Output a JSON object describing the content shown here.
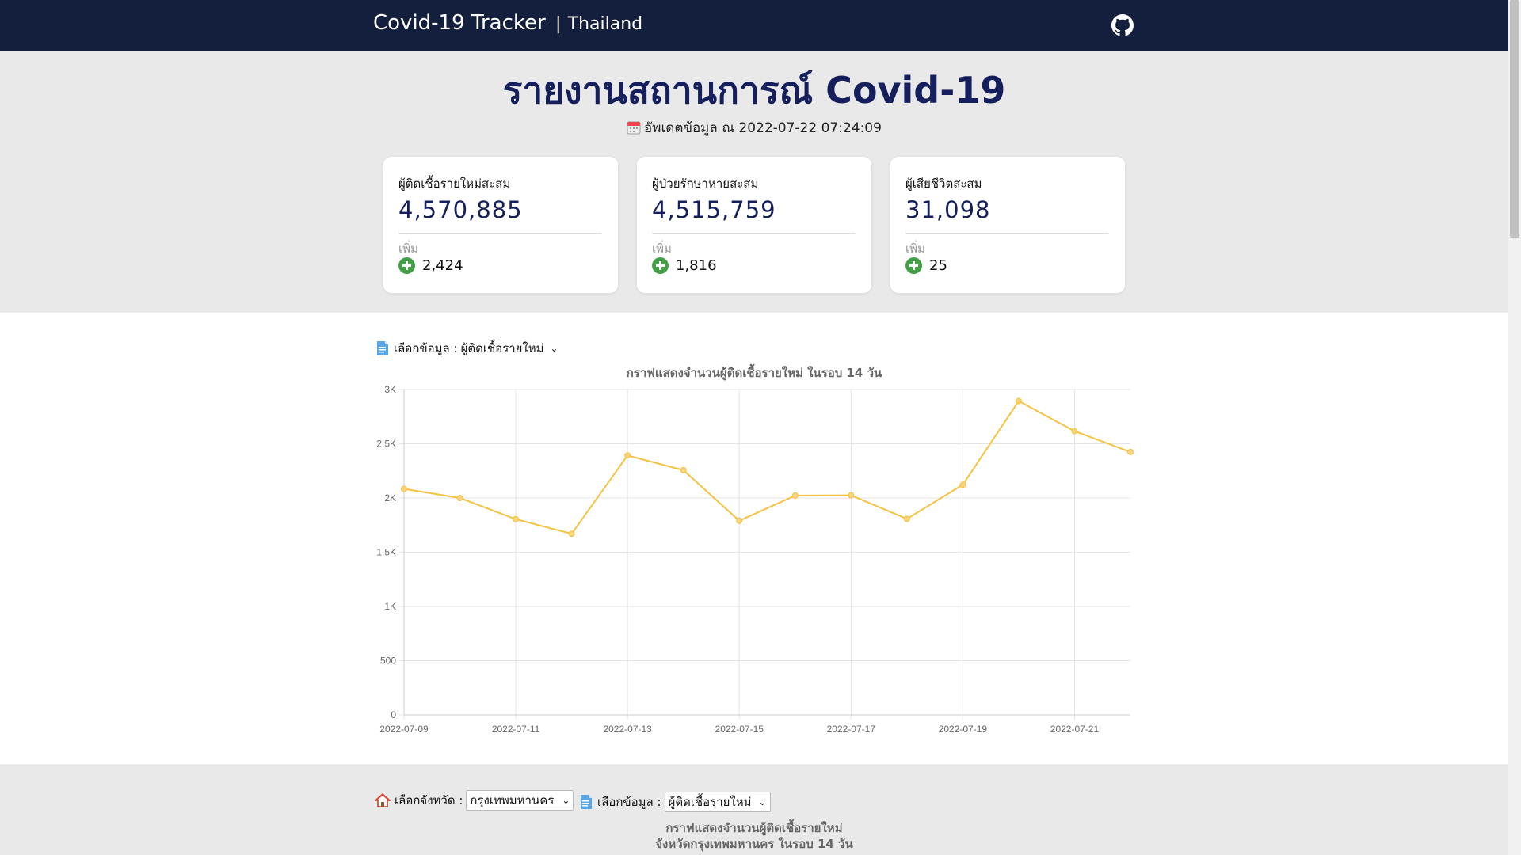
{
  "navbar": {
    "brand": "Covid-19 Tracker",
    "separator": "|",
    "country": "Thailand",
    "github_icon": "github-icon"
  },
  "header": {
    "title": "รายงานสถานการณ์ Covid-19",
    "updated": "อัพเดตข้อมูล ณ 2022-07-22 07:24:09",
    "calendar_icon": "calendar-icon"
  },
  "cards": [
    {
      "label": "ผู้ติดเชื้อรายใหม่สะสม",
      "value": "4,570,885",
      "increase_label": "เพิ่ม",
      "increase": "2,424"
    },
    {
      "label": "ผู้ป่วยรักษาหายสะสม",
      "value": "4,515,759",
      "increase_label": "เพิ่ม",
      "increase": "1,816"
    },
    {
      "label": "ผู้เสียชีวิตสะสม",
      "value": "31,098",
      "increase_label": "เพิ่ม",
      "increase": "25"
    }
  ],
  "main_selector": {
    "label": "เลือกข้อมูล :",
    "selected": "ผู้ติดเชื้อรายใหม่"
  },
  "chart_data": {
    "type": "line",
    "title": "กราฟแสดงจำนวนผู้ติดเชื้อรายใหม่ ในรอบ 14 วัน",
    "x": [
      "2022-07-09",
      "2022-07-10",
      "2022-07-11",
      "2022-07-12",
      "2022-07-13",
      "2022-07-14",
      "2022-07-15",
      "2022-07-16",
      "2022-07-17",
      "2022-07-18",
      "2022-07-19",
      "2022-07-20",
      "2022-07-21",
      "2022-07-22"
    ],
    "x_tick_labels": [
      "2022-07-09",
      "2022-07-11",
      "2022-07-13",
      "2022-07-15",
      "2022-07-17",
      "2022-07-19",
      "2022-07-21"
    ],
    "series": [
      {
        "values": [
          2084,
          2000,
          1804,
          1670,
          2392,
          2256,
          1790,
          2022,
          2025,
          1807,
          2122,
          2894,
          2616,
          2424
        ],
        "color": "#f5c242"
      }
    ],
    "ylim": [
      0,
      3000
    ],
    "y_ticks": [
      0,
      500,
      1000,
      1500,
      2000,
      2500,
      3000
    ],
    "y_tick_labels": [
      "0",
      "500",
      "1K",
      "1.5K",
      "2K",
      "2.5K",
      "3K"
    ],
    "grid": true
  },
  "province_section": {
    "province_label": "เลือกจังหวัด :",
    "province_selected": "กรุงเทพมหานคร",
    "data_label": "เลือกข้อมูล :",
    "data_selected": "ผู้ติดเชื้อรายใหม่",
    "title_line1": "กราฟแสดงจำนวนผู้ติดเชื้อรายใหม่",
    "title_line2": "จังหวัดกรุงเทพมหานคร ในรอบ 14 วัน"
  }
}
